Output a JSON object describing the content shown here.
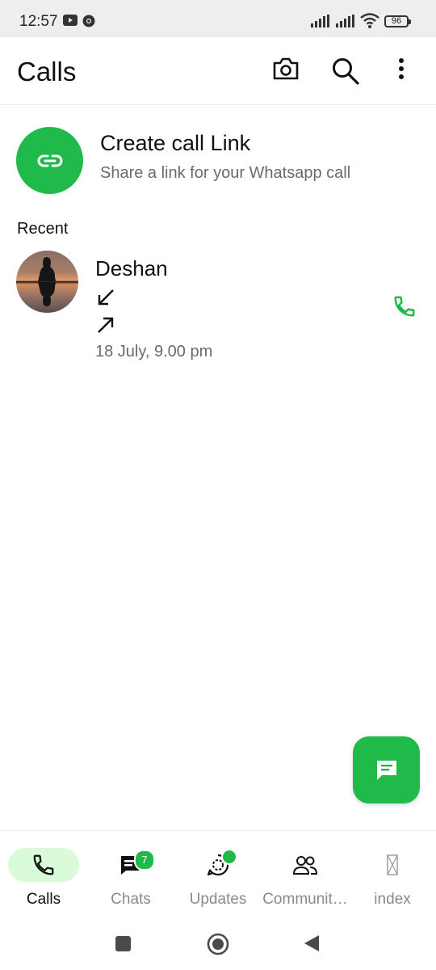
{
  "status": {
    "time": "12:57",
    "battery": "96"
  },
  "appbar": {
    "title": "Calls",
    "icons": [
      "camera-icon",
      "search-icon",
      "more-vert-icon"
    ]
  },
  "create_link": {
    "title": "Create call Link",
    "subtitle": "Share a link for your Whatsapp call",
    "icon": "link-icon"
  },
  "recent": {
    "label": "Recent",
    "calls": [
      {
        "name": "Deshan",
        "time": "18 July, 9.00 pm",
        "directions": [
          "incoming",
          "outgoing"
        ],
        "action_icon": "phone-icon"
      }
    ]
  },
  "fab": {
    "icon": "new-chat-icon"
  },
  "bottom_nav": {
    "items": [
      {
        "label": "Calls",
        "icon": "phone-icon",
        "active": true
      },
      {
        "label": "Chats",
        "icon": "chats-icon",
        "badge": "7"
      },
      {
        "label": "Updates",
        "icon": "updates-icon",
        "dot": true
      },
      {
        "label": "Communit…",
        "icon": "communities-icon"
      },
      {
        "label": "index",
        "icon": "index-icon"
      }
    ]
  },
  "colors": {
    "accent": "#1fba4a",
    "active_pill": "#d9fbd9",
    "secondary_text": "#6b6b6b"
  }
}
